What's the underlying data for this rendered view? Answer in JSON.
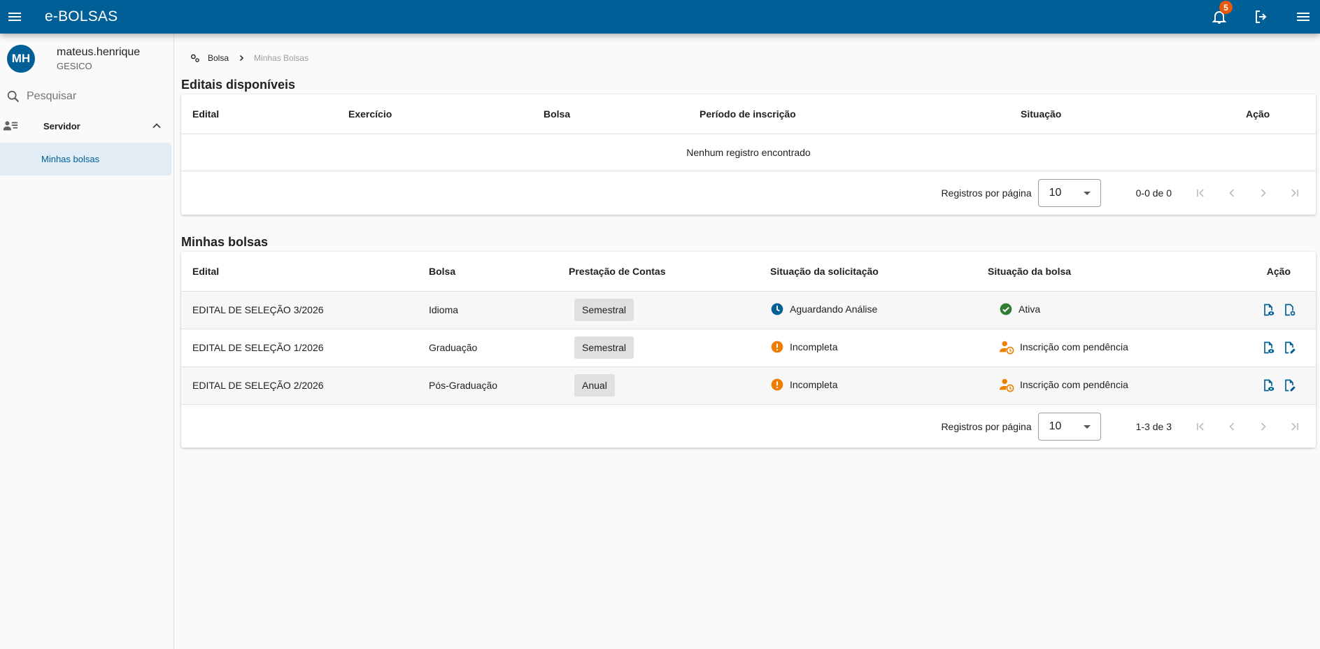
{
  "app": {
    "title": "e-BOLSAS",
    "notification_count": "5",
    "brand_color": "#005f96",
    "badge_color": "#e8590c"
  },
  "user": {
    "initials": "MH",
    "name": "mateus.henrique",
    "org": "GESICO"
  },
  "sidebar": {
    "search_placeholder": "Pesquisar",
    "group_label": "Servidor",
    "items": [
      {
        "label": "Minhas bolsas",
        "active": true
      }
    ]
  },
  "breadcrumb": {
    "root": "Bolsa",
    "current": "Minhas Bolsas"
  },
  "editais": {
    "title": "Editais disponíveis",
    "columns": [
      "Edital",
      "Exercício",
      "Bolsa",
      "Período de inscrição",
      "Situação",
      "Ação"
    ],
    "empty_text": "Nenhum registro encontrado",
    "paginator": {
      "label": "Registros por página",
      "page_size": "10",
      "range": "0-0 de 0"
    }
  },
  "minhas": {
    "title": "Minhas bolsas",
    "columns": [
      "Edital",
      "Bolsa",
      "Prestação de Contas",
      "Situação da solicitação",
      "Situação da bolsa",
      "Ação"
    ],
    "rows": [
      {
        "edital": "EDITAL DE SELEÇÃO 3/2026",
        "bolsa": "Idioma",
        "prestacao": "Semestral",
        "situacao_solicitacao": "Aguardando Análise",
        "solicitacao_icon": "clock-pending-icon",
        "situacao_bolsa": "Ativa",
        "bolsa_icon": "check-circle-icon"
      },
      {
        "edital": "EDITAL DE SELEÇÃO 1/2026",
        "bolsa": "Graduação",
        "prestacao": "Semestral",
        "situacao_solicitacao": "Incompleta",
        "solicitacao_icon": "alert-circle-icon",
        "situacao_bolsa": "Inscrição com pendência",
        "bolsa_icon": "user-clock-icon"
      },
      {
        "edital": "EDITAL DE SELEÇÃO 2/2026",
        "bolsa": "Pós-Graduação",
        "prestacao": "Anual",
        "situacao_solicitacao": "Incompleta",
        "solicitacao_icon": "alert-circle-icon",
        "situacao_bolsa": "Inscrição com pendência",
        "bolsa_icon": "user-clock-icon"
      }
    ],
    "paginator": {
      "label": "Registros por página",
      "page_size": "10",
      "range": "1-3 de 3"
    }
  },
  "colors": {
    "status_blue": "#005f96",
    "status_green": "#2e7d32",
    "status_orange": "#ef7d00"
  }
}
